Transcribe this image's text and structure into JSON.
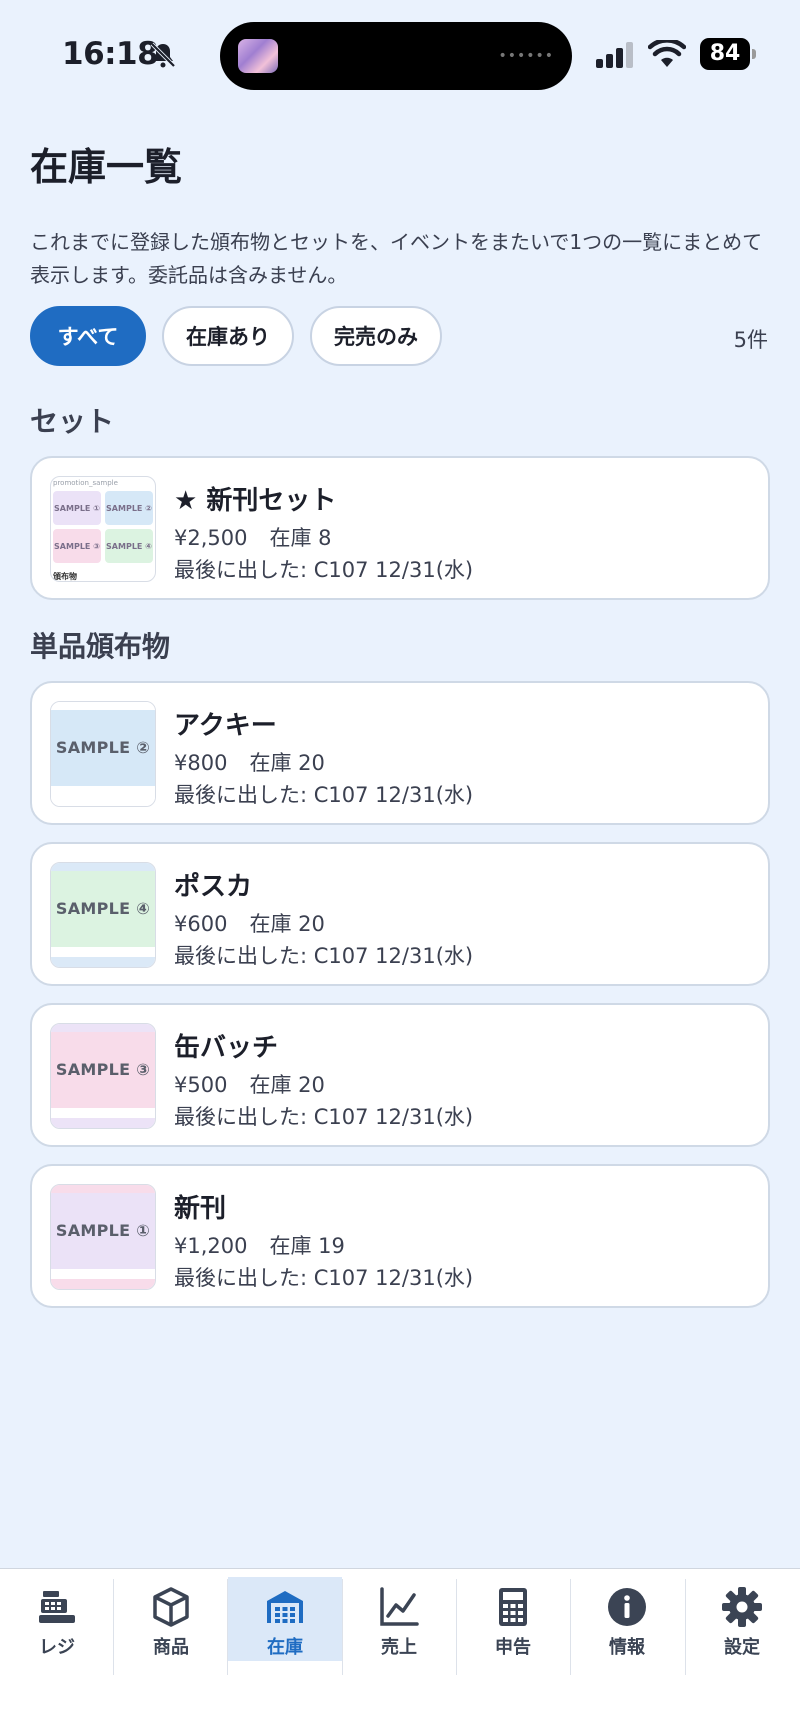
{
  "status_bar": {
    "time": "16:18",
    "battery": "84"
  },
  "header": {
    "title": "在庫一覧",
    "description": "これまでに登録した頒布物とセットを、イベントをまたいで1つの一覧にまとめて表示します。委託品は含みません。"
  },
  "filters": {
    "items": [
      {
        "label": "すべて",
        "active": true
      },
      {
        "label": "在庫あり",
        "active": false
      },
      {
        "label": "完売のみ",
        "active": false
      }
    ],
    "count": "5件"
  },
  "sets": {
    "title": "セット",
    "items": [
      {
        "name": "★ 新刊セット",
        "price": "¥2,500",
        "stock": "在庫 8",
        "last": "最後に出した: C107 12/31(水)",
        "thumb": {
          "top": "promotion_sample",
          "cells": [
            "SAMPLE ①",
            "SAMPLE ②",
            "SAMPLE ③",
            "SAMPLE ④"
          ],
          "bottom": "頒布物"
        }
      }
    ]
  },
  "singles": {
    "title": "単品頒布物",
    "items": [
      {
        "name": "アクキー",
        "price": "¥800",
        "stock": "在庫 20",
        "last": "最後に出した: C107 12/31(水)",
        "thumb_label": "SAMPLE ②",
        "thumb_color": "#d6e8f7",
        "stripe_color": "#ffffff"
      },
      {
        "name": "ポスカ",
        "price": "¥600",
        "stock": "在庫 20",
        "last": "最後に出した: C107 12/31(水)",
        "thumb_label": "SAMPLE ④",
        "thumb_color": "#dcf3e1",
        "stripe_color": "#dbe9f7"
      },
      {
        "name": "缶バッチ",
        "price": "¥500",
        "stock": "在庫 20",
        "last": "最後に出した: C107 12/31(水)",
        "thumb_label": "SAMPLE ③",
        "thumb_color": "#f8dcea",
        "stripe_color": "#ece3f7"
      },
      {
        "name": "新刊",
        "price": "¥1,200",
        "stock": "在庫 19",
        "last": "最後に出した: C107 12/31(水)",
        "thumb_label": "SAMPLE ①",
        "thumb_color": "#ebe2f7",
        "stripe_color": "#f8dcea"
      }
    ]
  },
  "nav": {
    "items": [
      {
        "label": "レジ",
        "icon": "register-icon",
        "active": false
      },
      {
        "label": "商品",
        "icon": "box-icon",
        "active": false
      },
      {
        "label": "在庫",
        "icon": "warehouse-icon",
        "active": true
      },
      {
        "label": "売上",
        "icon": "chart-icon",
        "active": false
      },
      {
        "label": "申告",
        "icon": "calculator-icon",
        "active": false
      },
      {
        "label": "情報",
        "icon": "info-icon",
        "active": false
      },
      {
        "label": "設定",
        "icon": "gear-icon",
        "active": false
      }
    ]
  },
  "colors": {
    "accent": "#1f6cc2",
    "background": "#eaf2fd"
  }
}
